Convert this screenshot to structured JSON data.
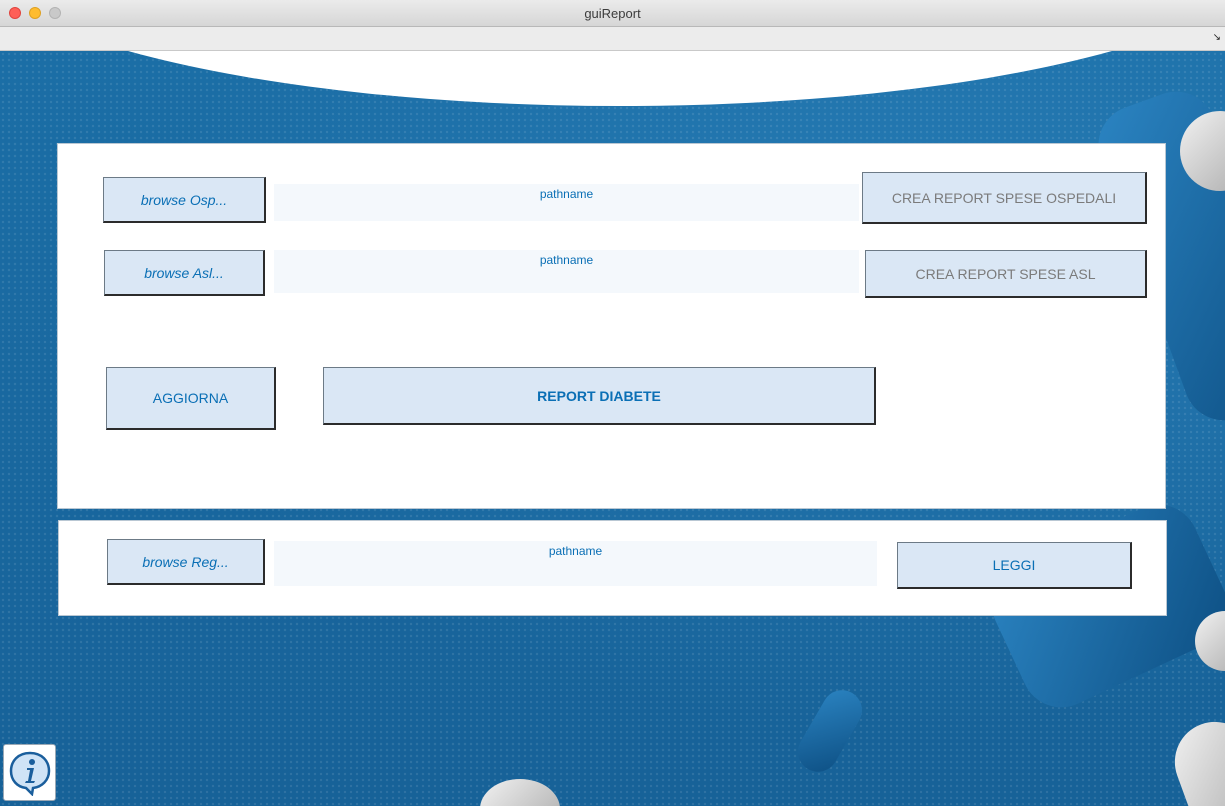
{
  "window": {
    "title": "guiReport"
  },
  "toolbar": {
    "resize_icon": "resize-arrow-icon"
  },
  "panel_top": {
    "row1": {
      "browse_label": "browse Osp...",
      "path": "pathname",
      "report_label": "CREA REPORT SPESE OSPEDALI"
    },
    "row2": {
      "browse_label": "browse Asl...",
      "path": "pathname",
      "report_label": "CREA REPORT SPESE ASL"
    },
    "aggiorna_label": "AGGIORNA",
    "diabete_label": "REPORT DIABETE"
  },
  "panel_bottom": {
    "browse_label": "browse Reg...",
    "path": "pathname",
    "leggi_label": "LEGGI"
  },
  "info": {
    "icon": "info-icon"
  },
  "colors": {
    "accent_text": "#0a6fb5",
    "button_bg": "#dae7f5",
    "background": "#1b6ea6"
  }
}
